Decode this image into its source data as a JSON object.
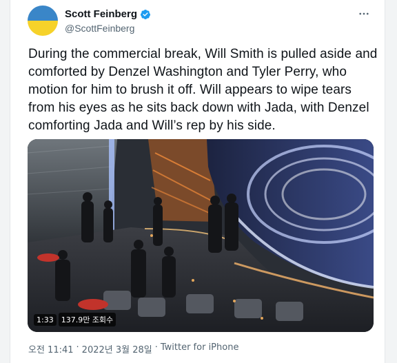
{
  "author": {
    "display_name": "Scott Feinberg",
    "handle": "@ScottFeinberg",
    "verified": true,
    "avatar_icon": "ukraine-flag-avatar",
    "avatar_colors": [
      "#3a86c8",
      "#f6d22a"
    ]
  },
  "tweet": {
    "text": "During the commercial break, Will Smith is pulled aside and comforted by Denzel Washington and Tyler Perry, who motion for him to brush it off. Will appears to wipe tears from his eyes as he sits back down with Jada, with Denzel comforting Jada and Will’s rep by his side."
  },
  "media": {
    "type": "video",
    "duration": "1:33",
    "views": "137.9만 조회수"
  },
  "meta": {
    "time": "오전 11:41",
    "separator": "·",
    "date": "2022년 3월 28일",
    "source": "Twitter for iPhone"
  },
  "icons": {
    "verified": "verified-badge-icon",
    "more": "more-options-icon"
  },
  "colors": {
    "verified_blue": "#1d9bf0",
    "secondary_text": "#536471",
    "primary_text": "#0f1419"
  }
}
